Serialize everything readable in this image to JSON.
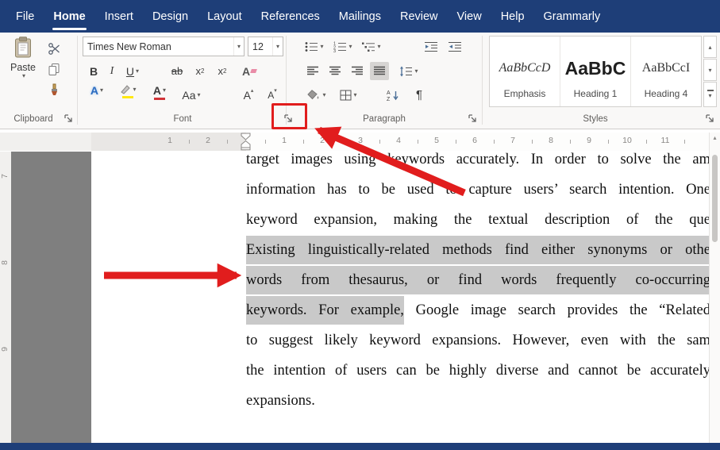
{
  "colors": {
    "theme-blue": "#1e3e78",
    "accent-red": "#e11d1d",
    "selection": "#c9c9c9",
    "doc-bg": "#7f7f7f",
    "ribbon-bg": "#f9f8f7"
  },
  "tabs": {
    "items": [
      {
        "label": "File",
        "active": false
      },
      {
        "label": "Home",
        "active": true
      },
      {
        "label": "Insert",
        "active": false
      },
      {
        "label": "Design",
        "active": false
      },
      {
        "label": "Layout",
        "active": false
      },
      {
        "label": "References",
        "active": false
      },
      {
        "label": "Mailings",
        "active": false
      },
      {
        "label": "Review",
        "active": false
      },
      {
        "label": "View",
        "active": false
      },
      {
        "label": "Help",
        "active": false
      },
      {
        "label": "Grammarly",
        "active": false
      }
    ]
  },
  "icons": {
    "chevron_down": "▾",
    "chevron_up": "▴",
    "pilcrow": "¶"
  },
  "ribbon": {
    "clipboard": {
      "group_label": "Clipboard",
      "paste_label": "Paste"
    },
    "font": {
      "group_label": "Font",
      "font_name": "Times New Roman",
      "font_size": "12",
      "bold": "B",
      "italic": "I",
      "underline": "U",
      "strikethrough": "ab",
      "subscript": "x",
      "sub2": "2",
      "superscript": "x",
      "sup2": "2",
      "clear": "A",
      "text_effects": "A",
      "font_color": "A",
      "change_case": "Aa",
      "grow": "A",
      "shrink": "A"
    },
    "paragraph": {
      "group_label": "Paragraph"
    },
    "styles": {
      "group_label": "Styles",
      "items": [
        {
          "preview": "AaBbCcD",
          "name": "Emphasis",
          "kind": "emphasis"
        },
        {
          "preview": "AaBbC",
          "name": "Heading 1",
          "kind": "h1"
        },
        {
          "preview": "AaBbCcI",
          "name": "Heading 4",
          "kind": "h4"
        }
      ]
    }
  },
  "ruler": {
    "h_left_numbers": [
      "2",
      "1"
    ],
    "h_right_numbers": [
      "1",
      "2",
      "3",
      "4",
      "5",
      "6",
      "7",
      "8",
      "9",
      "10",
      "11"
    ],
    "v_numbers": [
      "7",
      "8",
      "9"
    ]
  },
  "document": {
    "lines": [
      {
        "segments": [
          {
            "text": "target images using keywords accurately. In order to solve the am",
            "hl": false
          }
        ]
      },
      {
        "segments": [
          {
            "text": "information has to be used to capture users’ search intention. One",
            "hl": false
          }
        ]
      },
      {
        "segments": [
          {
            "text": "keyword expansion, making the textual description of the que",
            "hl": false
          }
        ]
      },
      {
        "segments": [
          {
            "text": "Existing linguistically-related methods find either synonyms or othe",
            "hl": true
          }
        ]
      },
      {
        "segments": [
          {
            "text": "words from thesaurus, or find words frequently co-occurring",
            "hl": true
          }
        ]
      },
      {
        "segments": [
          {
            "text": "keywords. For example,",
            "hl": true
          },
          {
            "text": " Google image search provides the “Related",
            "hl": false
          }
        ]
      },
      {
        "segments": [
          {
            "text": "to suggest likely keyword expansions. However, even with the sam",
            "hl": false
          }
        ]
      },
      {
        "segments": [
          {
            "text": "the intention of users can be highly diverse and cannot be accurately",
            "hl": false
          }
        ]
      },
      {
        "segments": [
          {
            "text": "expansions.",
            "hl": false
          }
        ],
        "last": true
      }
    ]
  }
}
